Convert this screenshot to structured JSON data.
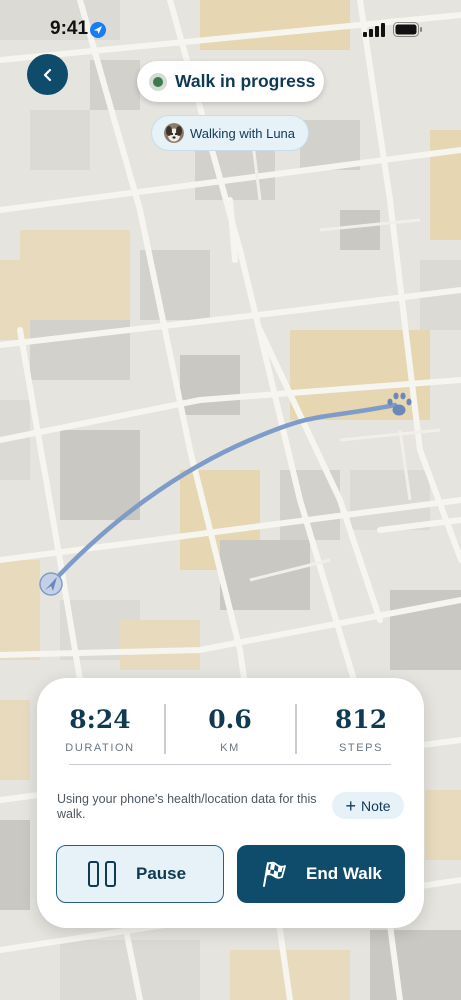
{
  "status_bar": {
    "time": "9:41",
    "icons": [
      "location-arrow-icon",
      "cellular-signal-icon",
      "battery-icon"
    ]
  },
  "header": {
    "back_icon": "chevron-left-icon",
    "walk_status": "Walk in progress",
    "companion_label": "Walking with Luna",
    "companion_avatar": "dog-avatar"
  },
  "map": {
    "start_marker": "navigation-arrow-icon",
    "end_marker": "paw-icon",
    "route_color": "#7f9cc9"
  },
  "stats": [
    {
      "value": "8:24",
      "label": "DURATION"
    },
    {
      "value": "0.6",
      "label": "KM"
    },
    {
      "value": "812",
      "label": "STEPS"
    }
  ],
  "health_note": "Using your phone's health/location data for this walk.",
  "note_button": {
    "icon": "plus-icon",
    "label": "Note"
  },
  "actions": {
    "pause": {
      "icon": "pause-icon",
      "label": "Pause"
    },
    "end": {
      "icon": "checkered-flag-icon",
      "label": "End Walk"
    }
  },
  "colors": {
    "primary": "#0f4c6c",
    "accent_light": "#e7f1f8",
    "status_green": "#3d7a4e",
    "map_background": "#e6e4de"
  }
}
